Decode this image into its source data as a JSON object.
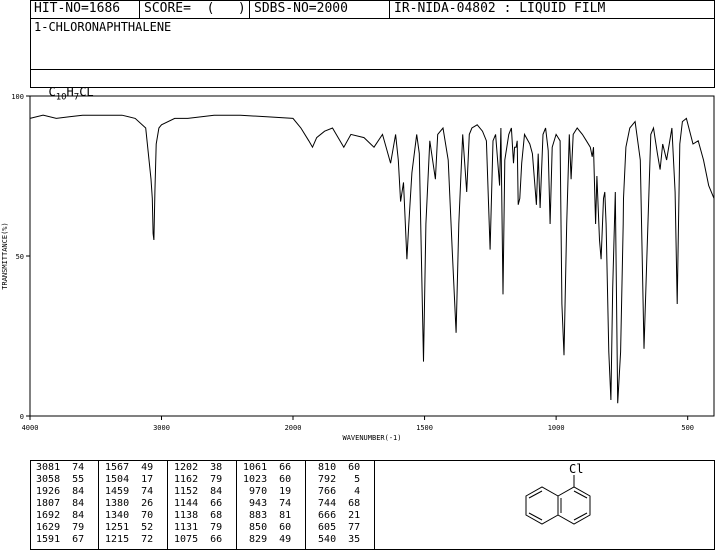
{
  "header": {
    "hit_no": "HIT-NO=1686",
    "score": "SCORE=  (   )",
    "sdbs_no": "SDBS-NO=2000",
    "method": "IR-NIDA-04802 : LIQUID FILM"
  },
  "compound_name": "1-CHLORONAPHTHALENE",
  "formula": {
    "c": "C",
    "c_sub": "10",
    "h": "H",
    "h_sub": "7",
    "rest": "CL"
  },
  "structure_label": "Cl",
  "chart_data": {
    "type": "line",
    "xlabel": "WAVENUMBER(-1)",
    "ylabel": "TRANSMITTANCE(%)",
    "xlim": [
      4000,
      400
    ],
    "ylim": [
      0,
      100
    ],
    "x_ticks": [
      "4000",
      "3000",
      "2000",
      "1500",
      "1000",
      "500"
    ],
    "y_ticks": [
      "100",
      "50",
      "0"
    ],
    "grid": false,
    "series": [
      {
        "x": [
          4000,
          3900,
          3800,
          3700,
          3600,
          3500,
          3400,
          3300,
          3200,
          3120,
          3080,
          3070,
          3064,
          3058,
          3050,
          3040,
          3020,
          3000,
          2900,
          2800,
          2600,
          2400,
          2200,
          2000,
          1970,
          1940,
          1926,
          1910,
          1880,
          1850,
          1807,
          1780,
          1730,
          1692,
          1660,
          1629,
          1610,
          1600,
          1591,
          1580,
          1567,
          1560,
          1548,
          1530,
          1520,
          1504,
          1495,
          1480,
          1459,
          1450,
          1430,
          1410,
          1395,
          1380,
          1370,
          1355,
          1340,
          1330,
          1320,
          1300,
          1280,
          1265,
          1251,
          1240,
          1230,
          1215,
          1210,
          1202,
          1195,
          1180,
          1170,
          1162,
          1158,
          1152,
          1148,
          1144,
          1138,
          1131,
          1120,
          1100,
          1090,
          1075,
          1068,
          1061,
          1050,
          1040,
          1030,
          1023,
          1015,
          1000,
          985,
          978,
          970,
          960,
          950,
          943,
          935,
          920,
          900,
          885,
          870,
          863,
          858,
          850,
          845,
          835,
          829,
          820,
          815,
          810,
          800,
          792,
          785,
          775,
          766,
          755,
          745,
          744,
          735,
          720,
          700,
          680,
          666,
          655,
          640,
          630,
          615,
          605,
          595,
          580,
          560,
          548,
          540,
          530,
          520,
          505,
          480,
          460,
          440,
          420,
          400
        ],
        "y": [
          93,
          94,
          93,
          93.5,
          94,
          94,
          94,
          94,
          93,
          90,
          74,
          68,
          57,
          55,
          70,
          85,
          90,
          91,
          93,
          93,
          94,
          94,
          93.5,
          93,
          90,
          86,
          84,
          87,
          89,
          90,
          84,
          88,
          87,
          84,
          88,
          79,
          88,
          80,
          67,
          73,
          49,
          60,
          76,
          88,
          82,
          17,
          60,
          86,
          74,
          88,
          90,
          80,
          52,
          26,
          60,
          88,
          70,
          88,
          90,
          91,
          89,
          86,
          52,
          86,
          88,
          72,
          90,
          38,
          80,
          88,
          90,
          79,
          84,
          84,
          86,
          66,
          68,
          79,
          88,
          85,
          82,
          66,
          82,
          65,
          88,
          90,
          83,
          60,
          84,
          88,
          86,
          35,
          19,
          60,
          88,
          74,
          88,
          90,
          88,
          86,
          84,
          81,
          84,
          60,
          75,
          55,
          49,
          68,
          70,
          60,
          20,
          5,
          40,
          70,
          4,
          20,
          60,
          68,
          84,
          90,
          92,
          80,
          21,
          50,
          88,
          90,
          82,
          77,
          85,
          80,
          90,
          70,
          35,
          85,
          92,
          93,
          85,
          86,
          80,
          72,
          68
        ]
      }
    ]
  },
  "peak_table": [
    [
      "3081",
      "74",
      "1567",
      "49",
      "1202",
      "38",
      "1061",
      "66",
      "810",
      "60"
    ],
    [
      "3058",
      "55",
      "1504",
      "17",
      "1162",
      "79",
      "1023",
      "60",
      "792",
      "5"
    ],
    [
      "1926",
      "84",
      "1459",
      "74",
      "1152",
      "84",
      "970",
      "19",
      "766",
      "4"
    ],
    [
      "1807",
      "84",
      "1380",
      "26",
      "1144",
      "66",
      "943",
      "74",
      "744",
      "68"
    ],
    [
      "1692",
      "84",
      "1340",
      "70",
      "1138",
      "68",
      "883",
      "81",
      "666",
      "21"
    ],
    [
      "1629",
      "79",
      "1251",
      "52",
      "1131",
      "79",
      "850",
      "60",
      "605",
      "77"
    ],
    [
      "1591",
      "67",
      "1215",
      "72",
      "1075",
      "66",
      "829",
      "49",
      "540",
      "35"
    ]
  ]
}
